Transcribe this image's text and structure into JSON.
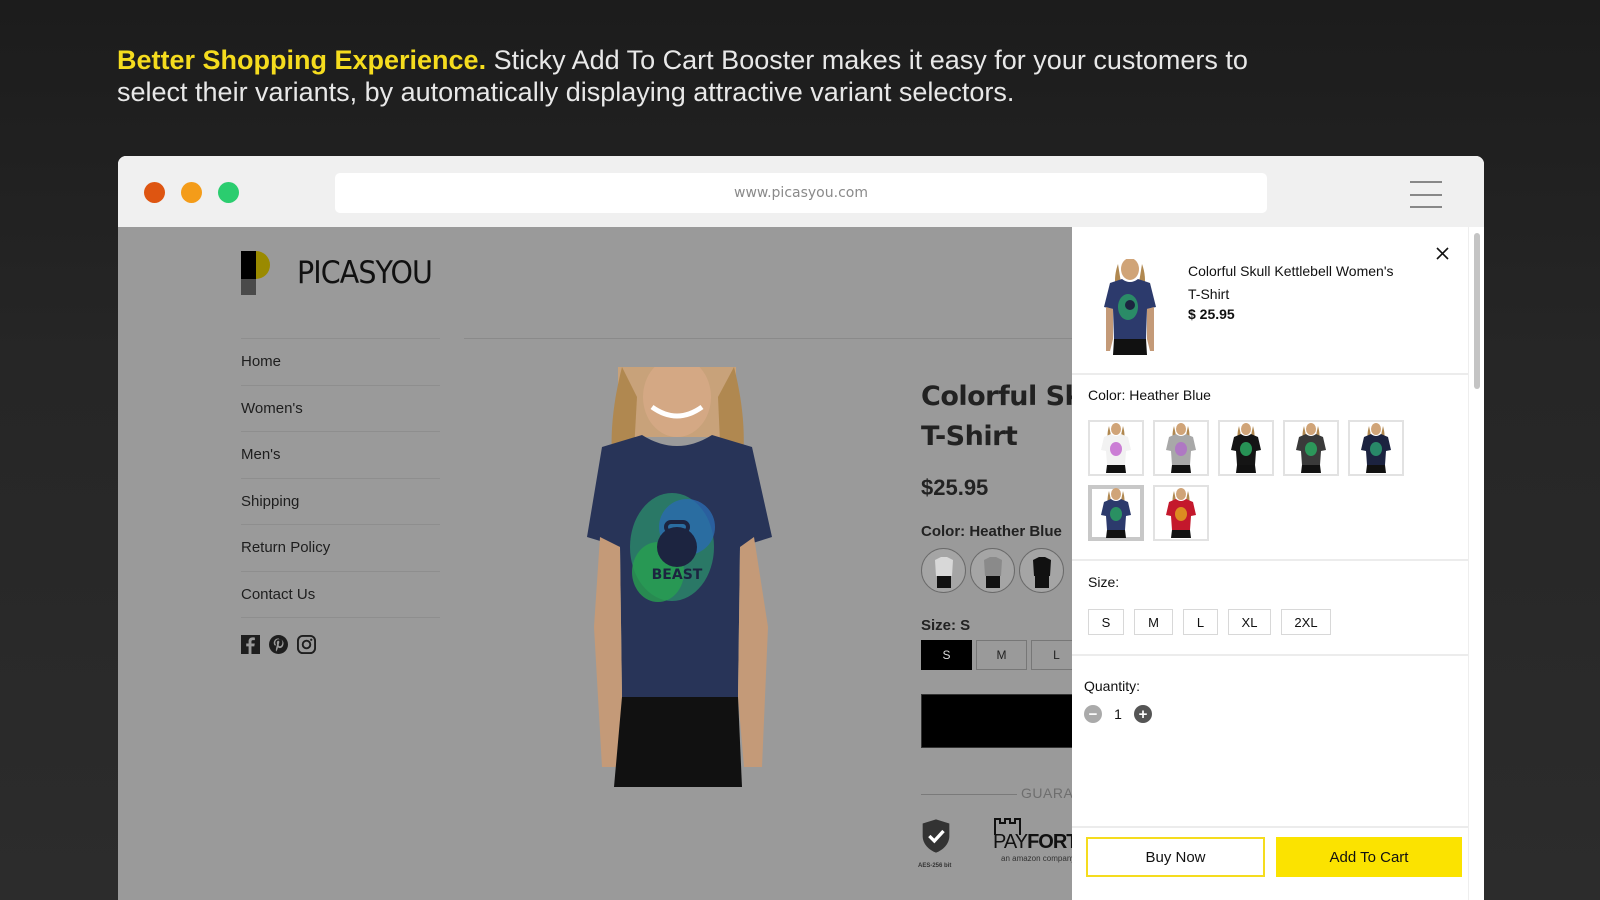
{
  "headline": {
    "highlight": "Better Shopping Experience.",
    "text": " Sticky Add To Cart Booster makes it easy for your customers to select their variants, by automatically displaying attractive variant selectors.",
    "highlight_color": "#f5dc1e"
  },
  "browser": {
    "url": "www.picasyou.com",
    "traffic_lights": [
      "#de5511",
      "#f49c19",
      "#2bcd6f"
    ],
    "menu_icon": "hamburger-icon"
  },
  "store": {
    "brand": "PICASYOU",
    "nav": [
      "Home",
      "Women's",
      "Men's",
      "Shipping",
      "Return Policy",
      "Contact Us"
    ],
    "social_icons": [
      "facebook-icon",
      "pinterest-icon",
      "instagram-icon"
    ]
  },
  "product": {
    "title_line1": "Colorful Skul",
    "title_line2": "T-Shirt",
    "price": "$25.95",
    "color_label": "Color:  Heather Blue",
    "color_swatches": [
      "#d8d8d8",
      "#9a9a9a",
      "#111111"
    ],
    "size_label": "Size:  S",
    "sizes": [
      "S",
      "M",
      "L"
    ],
    "selected_size": "S",
    "guarantee_text": "GUARA",
    "badge_aes": "AES-256 bit",
    "payfort_light": "PAY",
    "payfort_bold": "FORT",
    "payfort_sub": "an amazon company"
  },
  "drawer": {
    "product_name": "Colorful Skull Kettlebell Women's T-Shirt",
    "price": "$ 25.95",
    "color_label": "Color: Heather Blue",
    "swatches": [
      {
        "name": "White",
        "color": "#f2f2f2",
        "print": "#c46ad0"
      },
      {
        "name": "Heather Gray",
        "color": "#a8a8a8",
        "print": "#b070c8"
      },
      {
        "name": "Black",
        "color": "#151515",
        "print": "#2aa860"
      },
      {
        "name": "Charcoal",
        "color": "#3a3a3a",
        "print": "#2aa860"
      },
      {
        "name": "Navy",
        "color": "#1c2340",
        "print": "#2a9a70"
      },
      {
        "name": "Heather Blue",
        "color": "#2c3a6c",
        "print": "#2aa060",
        "selected": true
      },
      {
        "name": "Red",
        "color": "#c4182c",
        "print": "#e0a020"
      }
    ],
    "size_label": "Size:",
    "sizes": [
      "S",
      "M",
      "L",
      "XL",
      "2XL"
    ],
    "quantity_label": "Quantity:",
    "quantity": "1",
    "buy_now": "Buy Now",
    "add_to_cart": "Add To Cart",
    "accent_color": "#fbe300"
  }
}
